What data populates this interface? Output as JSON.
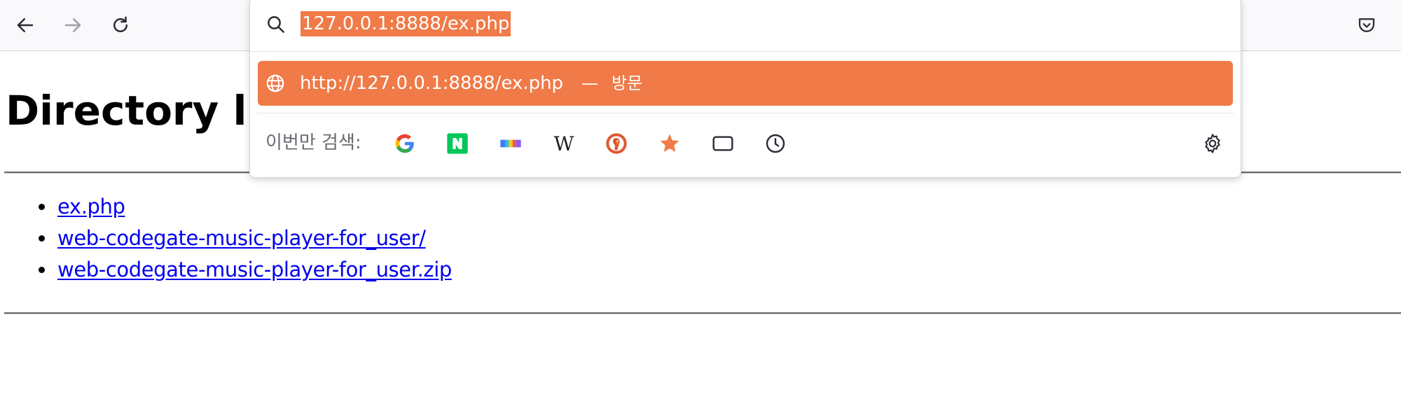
{
  "browser": {
    "toolbar": {
      "back_icon": "arrow-left-icon",
      "forward_icon": "arrow-right-icon",
      "reload_icon": "reload-icon",
      "pocket_icon": "pocket-icon"
    },
    "urlbar": {
      "value": "127.0.0.1:8888/ex.php",
      "selection_color": "#f07a48",
      "search_icon": "search-icon"
    },
    "suggestion": {
      "icon": "globe-icon",
      "url": "http://127.0.0.1:8888/ex.php",
      "separator": "—",
      "action": "방문",
      "highlight_color": "#f07a48"
    },
    "one_off": {
      "label": "이번만 검색:",
      "engines": [
        {
          "name": "google-icon"
        },
        {
          "name": "naver-icon",
          "letter": "N"
        },
        {
          "name": "color-bar-icon"
        },
        {
          "name": "wikipedia-icon",
          "letter": "W"
        },
        {
          "name": "duckduckgo-icon"
        },
        {
          "name": "bookmarks-star-icon"
        },
        {
          "name": "tabs-icon"
        },
        {
          "name": "history-clock-icon"
        }
      ],
      "settings_icon": "gear-icon"
    }
  },
  "page": {
    "title": "Directory listing for /",
    "files": [
      {
        "name": "ex.php"
      },
      {
        "name": "web-codegate-music-player-for_user/"
      },
      {
        "name": "web-codegate-music-player-for_user.zip"
      }
    ],
    "link_color": "#0000ee"
  }
}
